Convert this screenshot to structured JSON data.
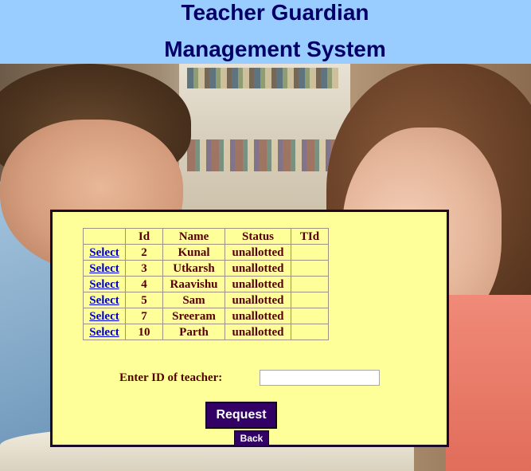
{
  "header": {
    "title_line1": "Teacher Guardian",
    "title_line2": "Management System"
  },
  "table": {
    "columns": [
      "",
      "Id",
      "Name",
      "Status",
      "TId"
    ],
    "rows": [
      {
        "action": "Select",
        "id": "2",
        "name": "Kunal",
        "status": "unallotted",
        "tid": ""
      },
      {
        "action": "Select",
        "id": "3",
        "name": "Utkarsh",
        "status": "unallotted",
        "tid": ""
      },
      {
        "action": "Select",
        "id": "4",
        "name": "Raavishu",
        "status": "unallotted",
        "tid": ""
      },
      {
        "action": "Select",
        "id": "5",
        "name": "Sam",
        "status": "unallotted",
        "tid": ""
      },
      {
        "action": "Select",
        "id": "7",
        "name": "Sreeram",
        "status": "unallotted",
        "tid": ""
      },
      {
        "action": "Select",
        "id": "10",
        "name": "Parth",
        "status": "unallotted",
        "tid": ""
      }
    ]
  },
  "form": {
    "teacher_id_label": "Enter ID of teacher:",
    "teacher_id_value": "",
    "request_label": "Request",
    "back_label": "Back"
  },
  "colors": {
    "header_bg": "#99ccff",
    "title_text": "#000066",
    "panel_bg": "#ffff99",
    "button_bg": "#330066",
    "link": "#0000cc",
    "table_text": "#550000"
  }
}
